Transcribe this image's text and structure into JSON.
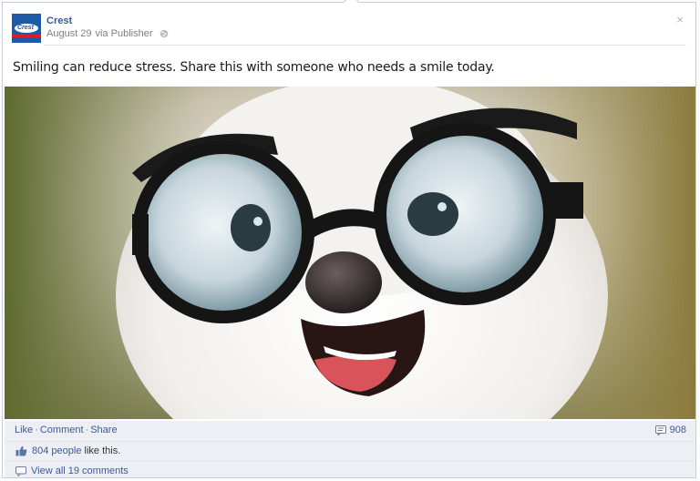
{
  "post": {
    "page_name": "Crest",
    "date": "August 29",
    "via": "via Publisher",
    "message": "Smiling can reduce stress. Share this with someone who needs a smile today.",
    "close_glyph": "×",
    "avatar_logo_text": "Crest"
  },
  "photo": {
    "description_icon": "dog-with-glasses-photo"
  },
  "actions": {
    "like": "Like",
    "comment": "Comment",
    "share": "Share",
    "separator": "·",
    "share_count": "908"
  },
  "likes": {
    "count_text": "804 people",
    "suffix": "like this."
  },
  "comments": {
    "view_all": "View all 19 comments"
  },
  "colors": {
    "link": "#3b5998",
    "bar_bg": "#edeff4",
    "border": "#c4cde0",
    "brand_blue": "#1f5aa8",
    "brand_red": "#d61f2a"
  }
}
